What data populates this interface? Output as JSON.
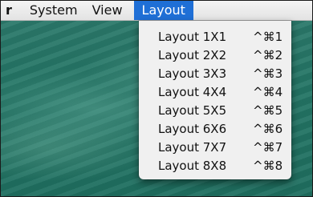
{
  "menubar": {
    "app_label": "r",
    "items": [
      "System",
      "View",
      "Layout"
    ],
    "active": "Layout"
  },
  "layout_menu": {
    "items": [
      {
        "label": "Layout 1X1",
        "shortcut": "^⌘1"
      },
      {
        "label": "Layout 2X2",
        "shortcut": "^⌘2"
      },
      {
        "label": "Layout 3X3",
        "shortcut": "^⌘3"
      },
      {
        "label": "Layout 4X4",
        "shortcut": "^⌘4"
      },
      {
        "label": "Layout 5X5",
        "shortcut": "^⌘5"
      },
      {
        "label": "Layout 6X6",
        "shortcut": "^⌘6"
      },
      {
        "label": "Layout 7X7",
        "shortcut": "^⌘7"
      },
      {
        "label": "Layout 8X8",
        "shortcut": "^⌘8"
      }
    ]
  },
  "colors": {
    "highlight": "#1f6fd6",
    "desktop": "#247565"
  }
}
